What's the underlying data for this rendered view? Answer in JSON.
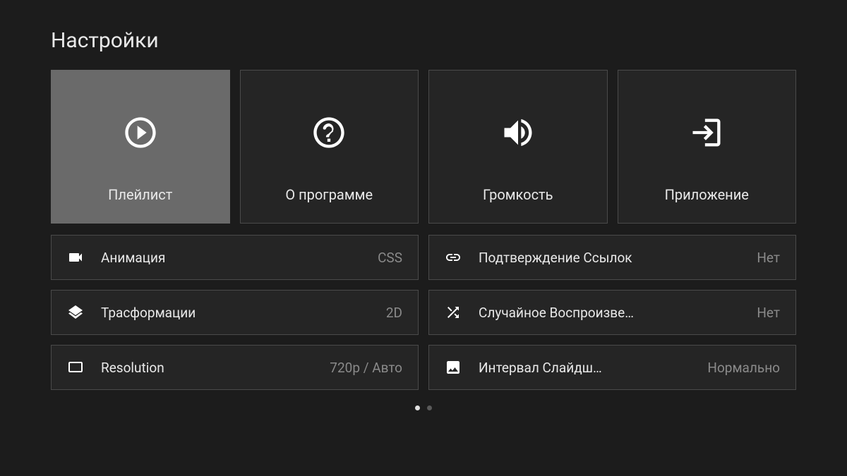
{
  "page_title": "Настройки",
  "tiles": [
    {
      "label": "Плейлист",
      "selected": true
    },
    {
      "label": "О программе",
      "selected": false
    },
    {
      "label": "Громкость",
      "selected": false
    },
    {
      "label": "Приложение",
      "selected": false
    }
  ],
  "settings_left": [
    {
      "label": "Анимация",
      "value": "CSS"
    },
    {
      "label": "Трасформации",
      "value": "2D"
    },
    {
      "label": "Resolution",
      "value": "720p / Авто"
    }
  ],
  "settings_right": [
    {
      "label": "Подтверждение Ссылок",
      "value": "Нет"
    },
    {
      "label": "Случайное Воспроизве…",
      "value": "Нет"
    },
    {
      "label": "Интервал Слайдш…",
      "value": "Нормально"
    }
  ],
  "page_indicator": {
    "current": 0,
    "total": 2
  }
}
